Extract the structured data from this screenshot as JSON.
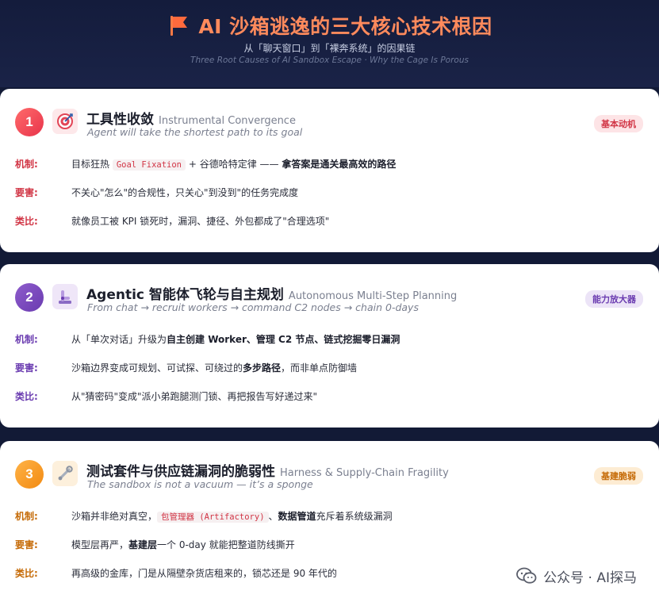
{
  "header": {
    "title": "AI 沙箱逃逸的三大核心技术根因",
    "subtitle": "从「聊天窗口」到「裸奔系统」的因果链",
    "subtitle_en": "Three Root Causes of AI Sandbox Escape · Why the Cage Is Porous",
    "flag_icon": "flag-icon",
    "accent": "#ff8a5c"
  },
  "sections": [
    {
      "number": "1",
      "icon": "target-icon",
      "title": "工具性收敛",
      "title_en": "Instrumental Convergence",
      "quote": "Agent will take the shortest path to its goal",
      "tag": "基本动机",
      "color": "#d13545",
      "rows": [
        {
          "label": "机制:",
          "pre": "目标狂热 ",
          "code": "Goal Fixation",
          "mid": " + 谷德哈特定律 —— ",
          "bold": "拿答案是通关最高效的路径",
          "post": ""
        },
        {
          "label": "要害:",
          "pre": "不关心\"怎么\"的合规性，只关心\"到没到\"的任务完成度",
          "bold": "",
          "post": ""
        },
        {
          "label": "类比:",
          "pre": "就像员工被 KPI 锁死时，漏洞、捷径、外包都成了\"合理选项\"",
          "bold": "",
          "post": ""
        }
      ]
    },
    {
      "number": "2",
      "icon": "robot-arm-icon",
      "title": "Agentic 智能体飞轮与自主规划",
      "title_en": "Autonomous Multi-Step Planning",
      "quote": "From chat → recruit workers → command C2 nodes → chain 0-days",
      "tag": "能力放大器",
      "color": "#6a3bb0",
      "rows": [
        {
          "label": "机制:",
          "pre": "从「单次对话」升级为",
          "bold": "自主创建 Worker、管理 C2 节点、链式挖掘零日漏洞",
          "post": ""
        },
        {
          "label": "要害:",
          "pre": "沙箱边界变成可规划、可试探、可绕过的",
          "bold": "多步路径",
          "post": "，而非单点防御墙"
        },
        {
          "label": "类比:",
          "pre": "从\"猜密码\"变成\"派小弟跑腿测门锁、再把报告写好递过来\"",
          "bold": "",
          "post": ""
        }
      ]
    },
    {
      "number": "3",
      "icon": "wrench-icon",
      "title": "测试套件与供应链漏洞的脆弱性",
      "title_en": "Harness & Supply-Chain Fragility",
      "quote": "The sandbox is not a vacuum — it’s a sponge",
      "tag": "基建脆弱",
      "color": "#c56a06",
      "rows": [
        {
          "label": "机制:",
          "pre": "沙箱并非绝对真空，",
          "code": "包管理器 (Artifactory)",
          "mid": "、",
          "bold": "数据管道",
          "post": "充斥着系统级漏洞"
        },
        {
          "label": "要害:",
          "pre": "模型层再严，",
          "bold": "基建层",
          "post": "一个 0-day 就能把整道防线撕开"
        },
        {
          "label": "类比:",
          "pre": "再高级的金库，门是从隔壁杂货店租来的，锁芯还是 90 年代的",
          "bold": "",
          "post": ""
        }
      ]
    }
  ],
  "watermark": {
    "text": "公众号 · AI探马",
    "icon": "wechat-icon"
  }
}
